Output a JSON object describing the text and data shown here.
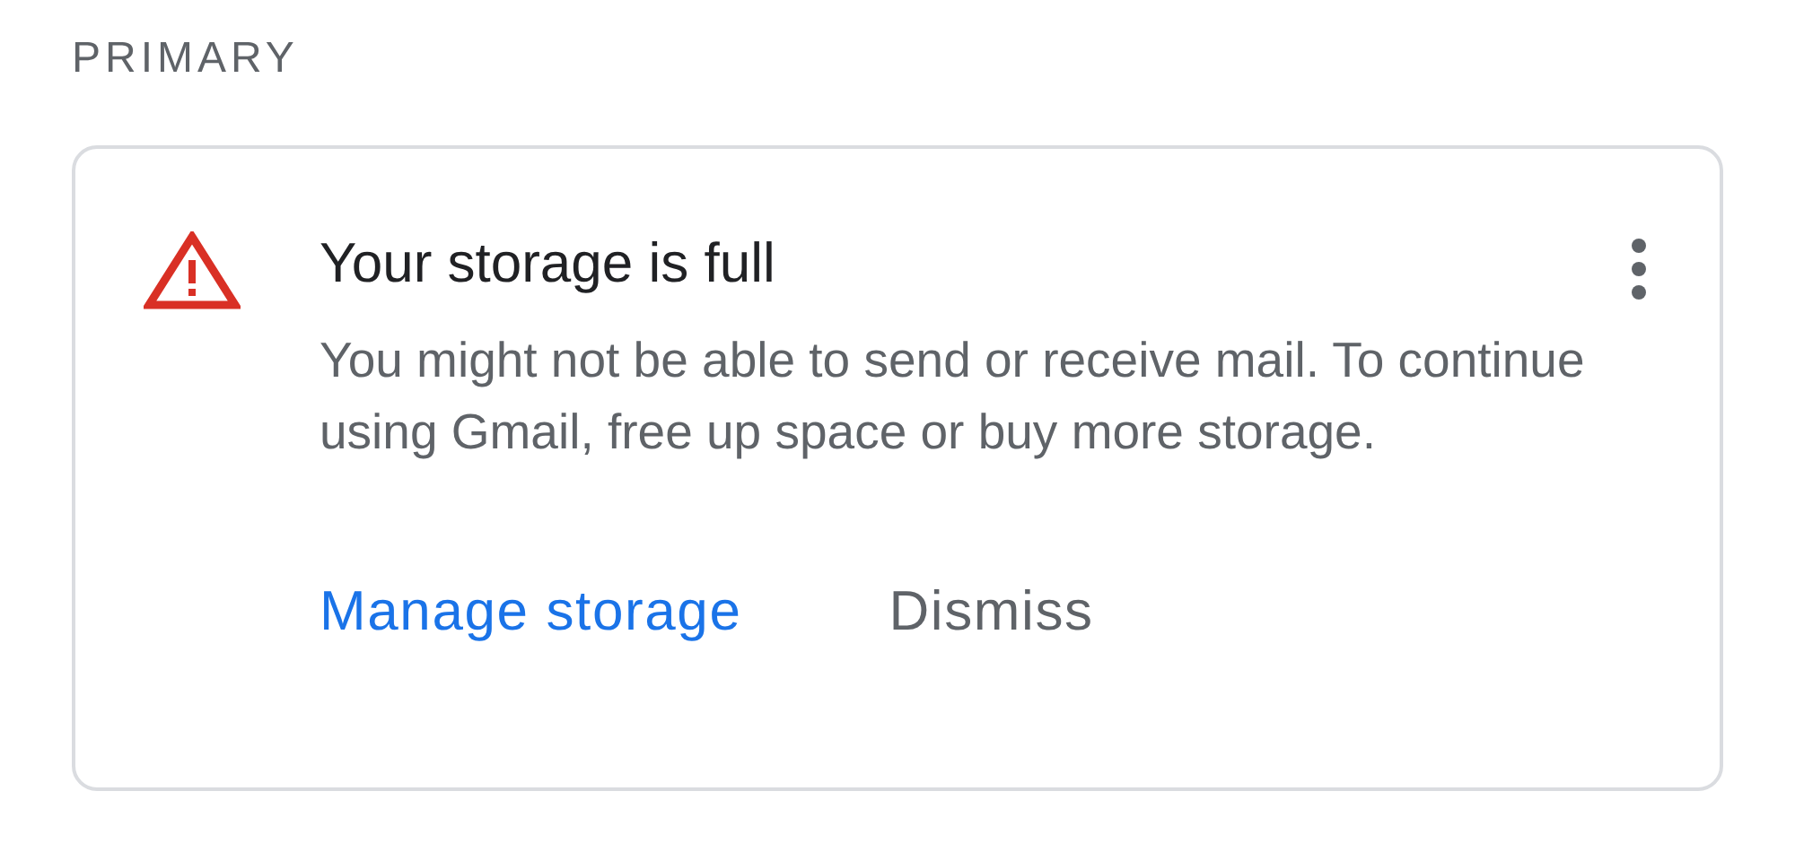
{
  "section": {
    "label": "PRIMARY"
  },
  "notice": {
    "title": "Your storage is full",
    "body": "You might not be able to send or receive mail. To continue using Gmail, free up space or buy more storage.",
    "actions": [
      {
        "label": "Manage storage",
        "kind": "primary"
      },
      {
        "label": "Dismiss",
        "kind": "secondary"
      }
    ]
  }
}
